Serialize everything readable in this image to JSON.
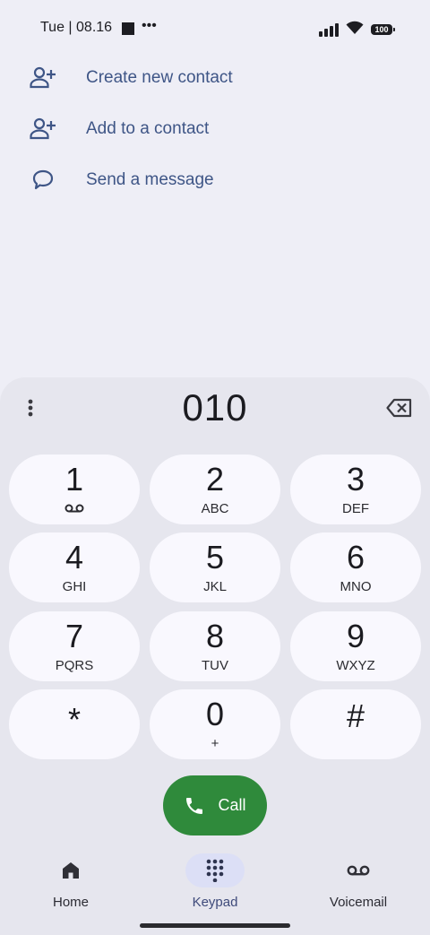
{
  "status_bar": {
    "time": "Tue | 08.16",
    "more_dots": "•••",
    "battery": "100"
  },
  "actions": [
    {
      "label": "Create new contact",
      "icon": "person-add-icon"
    },
    {
      "label": "Add to a contact",
      "icon": "person-add-icon"
    },
    {
      "label": "Send a message",
      "icon": "message-bubble-icon"
    }
  ],
  "dialer": {
    "number": "010",
    "keys": [
      {
        "digit": "1",
        "letters": ""
      },
      {
        "digit": "2",
        "letters": "ABC"
      },
      {
        "digit": "3",
        "letters": "DEF"
      },
      {
        "digit": "4",
        "letters": "GHI"
      },
      {
        "digit": "5",
        "letters": "JKL"
      },
      {
        "digit": "6",
        "letters": "MNO"
      },
      {
        "digit": "7",
        "letters": "PQRS"
      },
      {
        "digit": "8",
        "letters": "TUV"
      },
      {
        "digit": "9",
        "letters": "WXYZ"
      },
      {
        "digit": "*",
        "letters": ""
      },
      {
        "digit": "0",
        "letters": "+"
      },
      {
        "digit": "#",
        "letters": ""
      }
    ],
    "call_label": "Call"
  },
  "nav": {
    "items": [
      {
        "label": "Home",
        "icon": "home-icon",
        "active": false
      },
      {
        "label": "Keypad",
        "icon": "keypad-icon",
        "active": true
      },
      {
        "label": "Voicemail",
        "icon": "voicemail-icon",
        "active": false
      }
    ]
  },
  "colors": {
    "background": "#eeeef6",
    "dialer_panel": "#e6e6ee",
    "key_background": "#f9f8fe",
    "action_text": "#3e5586",
    "call_button": "#2f8a3b",
    "nav_active_pill": "#dcdff6"
  }
}
